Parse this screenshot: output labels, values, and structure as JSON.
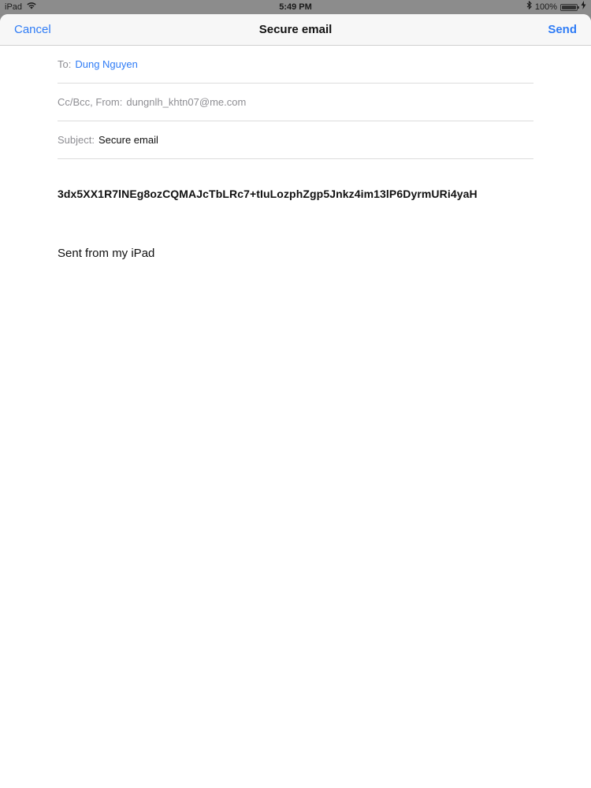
{
  "status_bar": {
    "device": "iPad",
    "time": "5:49 PM",
    "battery": "100%"
  },
  "nav": {
    "cancel": "Cancel",
    "title": "Secure email",
    "send": "Send"
  },
  "fields": {
    "to_label": "To:",
    "to_value": "Dung Nguyen",
    "ccbcc_label": "Cc/Bcc, From:",
    "ccbcc_value": "dungnlh_khtn07@me.com",
    "subject_label": "Subject:",
    "subject_value": "Secure email"
  },
  "body": {
    "encrypted_text": "3dx5XX1R7lNEg8ozCQMAJcTbLRc7+tIuLozphZgp5Jnkz4im13lP6DyrmURi4yaH",
    "signature": "Sent from my iPad"
  },
  "colors": {
    "accent": "#2f7cf6",
    "label_gray": "#8e8e93"
  },
  "icons": [
    "wifi-icon",
    "bluetooth-icon",
    "battery-icon",
    "charging-icon"
  ]
}
